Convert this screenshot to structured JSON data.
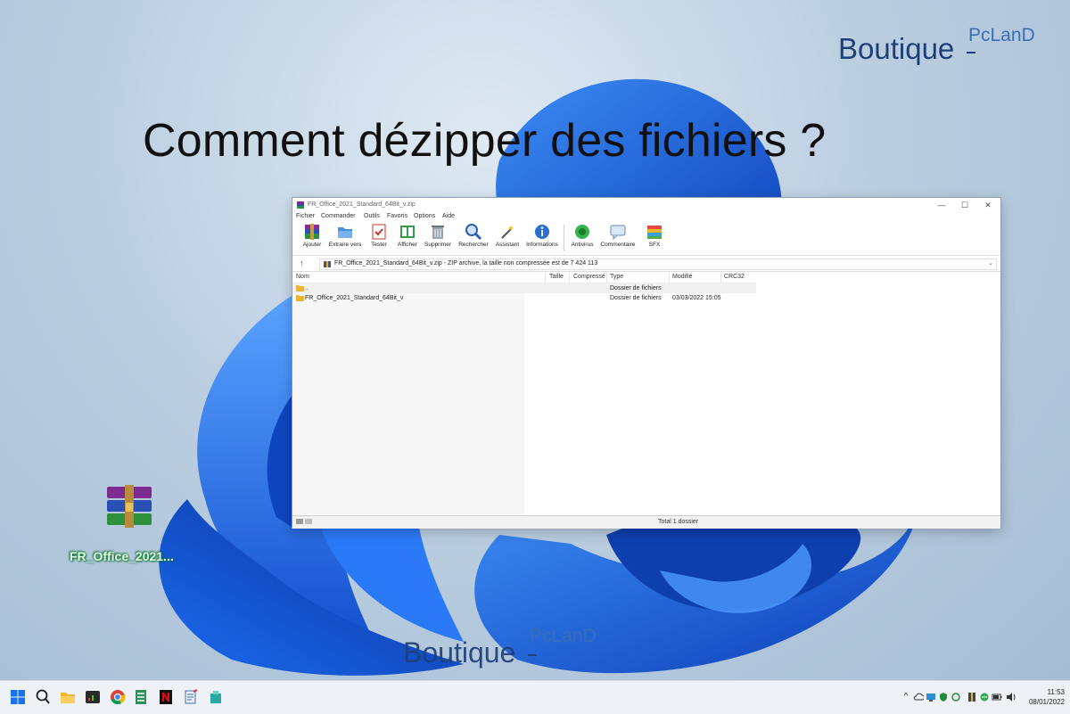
{
  "headline": "Comment dézipper des fichiers ?",
  "brand": {
    "main": "Boutique",
    "sup": "PcLanD"
  },
  "desktop_icon": {
    "label": "FR_Office_2021...",
    "icon": "winrar-archive-icon"
  },
  "window": {
    "title": "FR_Office_2021_Standard_64Bit_v.zip",
    "controls": {
      "minimize": "—",
      "maximize": "☐",
      "close": "✕"
    },
    "menu": [
      "Fichier",
      "Commander",
      "Outils",
      "Favoris",
      "Options",
      "Aide"
    ],
    "toolbar": [
      {
        "label": "Ajouter",
        "icon": "add-archive-icon"
      },
      {
        "label": "Extraire vers",
        "icon": "extract-to-icon"
      },
      {
        "label": "Tester",
        "icon": "test-icon"
      },
      {
        "label": "Afficher",
        "icon": "view-icon"
      },
      {
        "label": "Supprimer",
        "icon": "delete-icon"
      },
      {
        "label": "Rechercher",
        "icon": "find-icon"
      },
      {
        "label": "Assistant",
        "icon": "wizard-icon"
      },
      {
        "label": "Informations",
        "icon": "info-icon"
      },
      {
        "label": "Antivirus",
        "icon": "antivirus-icon"
      },
      {
        "label": "Commentaire",
        "icon": "comment-icon"
      },
      {
        "label": "SFX",
        "icon": "sfx-icon"
      }
    ],
    "address": {
      "up": "↑",
      "path": "FR_Office_2021_Standard_64Bit_v.zip - ZIP archive, la taille non compressée est de 7 424 113",
      "dropdown": "⌄"
    },
    "columns": [
      "Nom",
      "Taille",
      "Compressé",
      "Type",
      "Modifié",
      "CRC32"
    ],
    "rows": [
      {
        "name": "..",
        "size": "",
        "packed": "",
        "type": "Dossier de fichiers",
        "modified": "",
        "crc": ""
      },
      {
        "name": "FR_Office_2021_Standard_64Bit_v",
        "size": "",
        "packed": "",
        "type": "Dossier de fichiers",
        "modified": "03/03/2022 15:05",
        "crc": ""
      }
    ],
    "status": "Total 1 dossier"
  },
  "taskbar": {
    "apps": [
      "windows-start-icon",
      "search-icon",
      "file-explorer-icon",
      "terminal-icon",
      "chrome-icon",
      "winrar-icon",
      "netflix-icon",
      "notepad-icon",
      "app-icon"
    ],
    "tray": [
      "chevron-up-icon",
      "cloud-icon",
      "monitor-icon",
      "shield-icon",
      "sync-icon",
      "rar-icon",
      "network-icon",
      "battery-icon",
      "volume-icon"
    ],
    "time": "11:53",
    "date": "08/01/2022"
  },
  "colors": {
    "accent": "#1a5fd6",
    "taskbar": "#eef2f7",
    "window_bg": "#ffffff"
  }
}
